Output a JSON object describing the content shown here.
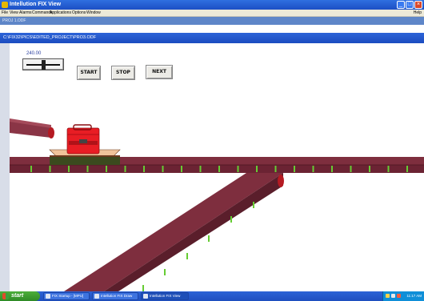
{
  "window": {
    "title": "Intellution FIX View",
    "buttons": [
      "minimize",
      "maximize",
      "close"
    ]
  },
  "menu": {
    "items": [
      "File",
      "View",
      "Alarms",
      "Commands",
      "Applications",
      "Options",
      "Window"
    ],
    "help": "Help"
  },
  "path_bar": {
    "text": "PROJ 1.ODF"
  },
  "document": {
    "title": "C:\\FIX32\\PICS\\EDITED_PROJECT\\PRO3.ODF"
  },
  "controls": {
    "slider_value": "240.00",
    "slider_fraction": 0.5,
    "start_label": "START",
    "stop_label": "STOP",
    "next_label": "NEXT"
  },
  "taskbar": {
    "start_label": "start",
    "tasks": [
      "FIX Startup - [MPU]",
      "Intellution FIX Draw",
      "Intellution FIX View"
    ],
    "clock": "11:17 AM"
  },
  "colors": {
    "conveyor": "#7e2e3e",
    "conveyor_dark": "#5a1e2b",
    "roller": "#66cc33",
    "roller_end": "#b51a22",
    "platform": "#f0c39a",
    "platform_base": "#3b4a1e",
    "box": "#e81d24",
    "titlebar": "#1c4fc4",
    "taskbar_start": "#2f8a26"
  }
}
